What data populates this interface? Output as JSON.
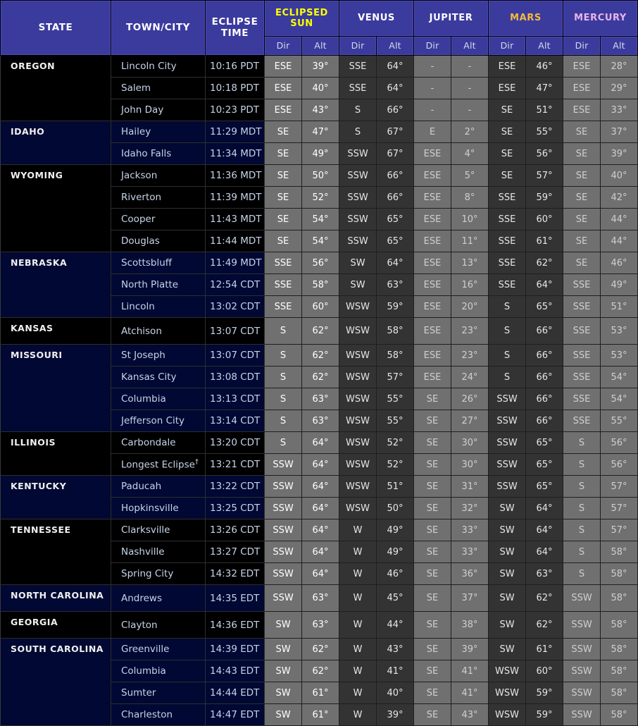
{
  "table": {
    "headers": {
      "state": "STATE",
      "town": "TOWN/CITY",
      "time": "ECLIPSE TIME",
      "time_line1": "ECLIPSE",
      "time_line2": "TIME",
      "groups": [
        {
          "label": "ECLIPSED SUN",
          "line1": "ECLIPSED",
          "line2": "SUN",
          "color": "#ffff00"
        },
        {
          "label": "VENUS",
          "color": "#ffffff"
        },
        {
          "label": "JUPITER",
          "color": "#fdfdff"
        },
        {
          "label": "MARS",
          "color": "#f2bb3d"
        },
        {
          "label": "MERCURY",
          "color": "#e8b5e8"
        }
      ],
      "sub": [
        "Dir",
        "Alt",
        "Dir",
        "Alt",
        "Dir",
        "Alt",
        "Dir",
        "Alt",
        "Dir",
        "Alt"
      ]
    },
    "colors": {
      "header_bg": "#3b3b9e",
      "block_a_bg": "#000000",
      "block_b_bg": "#000833",
      "light_cell_bg": "#707070",
      "dark_cell_bg": "#333333",
      "town_text": "#c6d4e8"
    },
    "states": [
      {
        "name": "OREGON",
        "block": "a",
        "rows": [
          {
            "town": "Lincoln City",
            "time": "10:16 PDT",
            "sun_dir": "ESE",
            "sun_alt": "39°",
            "venus_dir": "SSE",
            "venus_alt": "64°",
            "jupiter_dir": "-",
            "jupiter_alt": "-",
            "mars_dir": "ESE",
            "mars_alt": "46°",
            "mercury_dir": "ESE",
            "mercury_alt": "28°"
          },
          {
            "town": "Salem",
            "time": "10:18 PDT",
            "sun_dir": "ESE",
            "sun_alt": "40°",
            "venus_dir": "SSE",
            "venus_alt": "64°",
            "jupiter_dir": "-",
            "jupiter_alt": "-",
            "mars_dir": "ESE",
            "mars_alt": "47°",
            "mercury_dir": "ESE",
            "mercury_alt": "29°"
          },
          {
            "town": "John Day",
            "time": "10:23 PDT",
            "sun_dir": "ESE",
            "sun_alt": "43°",
            "venus_dir": "S",
            "venus_alt": "66°",
            "jupiter_dir": "-",
            "jupiter_alt": "-",
            "mars_dir": "SE",
            "mars_alt": "51°",
            "mercury_dir": "ESE",
            "mercury_alt": "33°"
          }
        ]
      },
      {
        "name": "IDAHO",
        "block": "b",
        "rows": [
          {
            "town": "Hailey",
            "time": "11:29 MDT",
            "sun_dir": "SE",
            "sun_alt": "47°",
            "venus_dir": "S",
            "venus_alt": "67°",
            "jupiter_dir": "E",
            "jupiter_alt": "2°",
            "mars_dir": "SE",
            "mars_alt": "55°",
            "mercury_dir": "SE",
            "mercury_alt": "37°"
          },
          {
            "town": "Idaho Falls",
            "time": "11:34 MDT",
            "sun_dir": "SE",
            "sun_alt": "49°",
            "venus_dir": "SSW",
            "venus_alt": "67°",
            "jupiter_dir": "ESE",
            "jupiter_alt": "4°",
            "mars_dir": "SE",
            "mars_alt": "56°",
            "mercury_dir": "SE",
            "mercury_alt": "39°"
          }
        ]
      },
      {
        "name": "WYOMING",
        "block": "a",
        "rows": [
          {
            "town": "Jackson",
            "time": "11:36 MDT",
            "sun_dir": "SE",
            "sun_alt": "50°",
            "venus_dir": "SSW",
            "venus_alt": "66°",
            "jupiter_dir": "ESE",
            "jupiter_alt": "5°",
            "mars_dir": "SE",
            "mars_alt": "57°",
            "mercury_dir": "SE",
            "mercury_alt": "40°"
          },
          {
            "town": "Riverton",
            "time": "11:39 MDT",
            "sun_dir": "SE",
            "sun_alt": "52°",
            "venus_dir": "SSW",
            "venus_alt": "66°",
            "jupiter_dir": "ESE",
            "jupiter_alt": "8°",
            "mars_dir": "SSE",
            "mars_alt": "59°",
            "mercury_dir": "SE",
            "mercury_alt": "42°"
          },
          {
            "town": "Cooper",
            "time": "11:43 MDT",
            "sun_dir": "SE",
            "sun_alt": "54°",
            "venus_dir": "SSW",
            "venus_alt": "65°",
            "jupiter_dir": "ESE",
            "jupiter_alt": "10°",
            "mars_dir": "SSE",
            "mars_alt": "60°",
            "mercury_dir": "SE",
            "mercury_alt": "44°"
          },
          {
            "town": "Douglas",
            "time": "11:44 MDT",
            "sun_dir": "SE",
            "sun_alt": "54°",
            "venus_dir": "SSW",
            "venus_alt": "65°",
            "jupiter_dir": "ESE",
            "jupiter_alt": "11°",
            "mars_dir": "SSE",
            "mars_alt": "61°",
            "mercury_dir": "SE",
            "mercury_alt": "44°"
          }
        ]
      },
      {
        "name": "NEBRASKA",
        "block": "b",
        "rows": [
          {
            "town": "Scottsbluff",
            "time": "11:49 MDT",
            "sun_dir": "SSE",
            "sun_alt": "56°",
            "venus_dir": "SW",
            "venus_alt": "64°",
            "jupiter_dir": "ESE",
            "jupiter_alt": "13°",
            "mars_dir": "SSE",
            "mars_alt": "62°",
            "mercury_dir": "SE",
            "mercury_alt": "46°"
          },
          {
            "town": "North Platte",
            "time": "12:54 CDT",
            "sun_dir": "SSE",
            "sun_alt": "58°",
            "venus_dir": "SW",
            "venus_alt": "63°",
            "jupiter_dir": "ESE",
            "jupiter_alt": "16°",
            "mars_dir": "SSE",
            "mars_alt": "64°",
            "mercury_dir": "SSE",
            "mercury_alt": "49°"
          },
          {
            "town": "Lincoln",
            "time": "13:02 CDT",
            "sun_dir": "SSE",
            "sun_alt": "60°",
            "venus_dir": "WSW",
            "venus_alt": "59°",
            "jupiter_dir": "ESE",
            "jupiter_alt": "20°",
            "mars_dir": "S",
            "mars_alt": "65°",
            "mercury_dir": "SSE",
            "mercury_alt": "51°"
          }
        ]
      },
      {
        "name": "KANSAS",
        "block": "a",
        "rows": [
          {
            "town": "Atchison",
            "time": "13:07 CDT",
            "sun_dir": "S",
            "sun_alt": "62°",
            "venus_dir": "WSW",
            "venus_alt": "58°",
            "jupiter_dir": "ESE",
            "jupiter_alt": "23°",
            "mars_dir": "S",
            "mars_alt": "66°",
            "mercury_dir": "SSE",
            "mercury_alt": "53°"
          }
        ]
      },
      {
        "name": "MISSOURI",
        "block": "b",
        "rows": [
          {
            "town": "St Joseph",
            "time": "13:07 CDT",
            "sun_dir": "S",
            "sun_alt": "62°",
            "venus_dir": "WSW",
            "venus_alt": "58°",
            "jupiter_dir": "ESE",
            "jupiter_alt": "23°",
            "mars_dir": "S",
            "mars_alt": "66°",
            "mercury_dir": "SSE",
            "mercury_alt": "53°"
          },
          {
            "town": "Kansas City",
            "time": "13:08 CDT",
            "sun_dir": "S",
            "sun_alt": "62°",
            "venus_dir": "WSW",
            "venus_alt": "57°",
            "jupiter_dir": "ESE",
            "jupiter_alt": "24°",
            "mars_dir": "S",
            "mars_alt": "66°",
            "mercury_dir": "SSE",
            "mercury_alt": "54°"
          },
          {
            "town": "Columbia",
            "time": "13:13 CDT",
            "sun_dir": "S",
            "sun_alt": "63°",
            "venus_dir": "WSW",
            "venus_alt": "55°",
            "jupiter_dir": "SE",
            "jupiter_alt": "26°",
            "mars_dir": "SSW",
            "mars_alt": "66°",
            "mercury_dir": "SSE",
            "mercury_alt": "54°"
          },
          {
            "town": "Jefferson City",
            "time": "13:14 CDT",
            "sun_dir": "S",
            "sun_alt": "63°",
            "venus_dir": "WSW",
            "venus_alt": "55°",
            "jupiter_dir": "SE",
            "jupiter_alt": "27°",
            "mars_dir": "SSW",
            "mars_alt": "66°",
            "mercury_dir": "SSE",
            "mercury_alt": "55°"
          }
        ]
      },
      {
        "name": "ILLINOIS",
        "block": "a",
        "rows": [
          {
            "town": "Carbondale",
            "time": "13:20 CDT",
            "sun_dir": "S",
            "sun_alt": "64°",
            "venus_dir": "WSW",
            "venus_alt": "52°",
            "jupiter_dir": "SE",
            "jupiter_alt": "30°",
            "mars_dir": "SSW",
            "mars_alt": "65°",
            "mercury_dir": "S",
            "mercury_alt": "56°"
          },
          {
            "town": "Longest Eclipse",
            "town_dagger": "†",
            "time": "13:21 CDT",
            "sun_dir": "SSW",
            "sun_alt": "64°",
            "venus_dir": "WSW",
            "venus_alt": "52°",
            "jupiter_dir": "SE",
            "jupiter_alt": "30°",
            "mars_dir": "SSW",
            "mars_alt": "65°",
            "mercury_dir": "S",
            "mercury_alt": "56°"
          }
        ]
      },
      {
        "name": "KENTUCKY",
        "block": "b",
        "rows": [
          {
            "town": "Paducah",
            "time": "13:22 CDT",
            "sun_dir": "SSW",
            "sun_alt": "64°",
            "venus_dir": "WSW",
            "venus_alt": "51°",
            "jupiter_dir": "SE",
            "jupiter_alt": "31°",
            "mars_dir": "SSW",
            "mars_alt": "65°",
            "mercury_dir": "S",
            "mercury_alt": "57°"
          },
          {
            "town": "Hopkinsville",
            "time": "13:25 CDT",
            "sun_dir": "SSW",
            "sun_alt": "64°",
            "venus_dir": "WSW",
            "venus_alt": "50°",
            "jupiter_dir": "SE",
            "jupiter_alt": "32°",
            "mars_dir": "SW",
            "mars_alt": "64°",
            "mercury_dir": "S",
            "mercury_alt": "57°"
          }
        ]
      },
      {
        "name": "TENNESSEE",
        "block": "a",
        "rows": [
          {
            "town": "Clarksville",
            "time": "13:26 CDT",
            "sun_dir": "SSW",
            "sun_alt": "64°",
            "venus_dir": "W",
            "venus_alt": "49°",
            "jupiter_dir": "SE",
            "jupiter_alt": "33°",
            "mars_dir": "SW",
            "mars_alt": "64°",
            "mercury_dir": "S",
            "mercury_alt": "57°"
          },
          {
            "town": "Nashville",
            "time": "13:27 CDT",
            "sun_dir": "SSW",
            "sun_alt": "64°",
            "venus_dir": "W",
            "venus_alt": "49°",
            "jupiter_dir": "SE",
            "jupiter_alt": "33°",
            "mars_dir": "SW",
            "mars_alt": "64°",
            "mercury_dir": "S",
            "mercury_alt": "58°"
          },
          {
            "town": "Spring City",
            "time": "14:32 EDT",
            "sun_dir": "SSW",
            "sun_alt": "64°",
            "venus_dir": "W",
            "venus_alt": "46°",
            "jupiter_dir": "SE",
            "jupiter_alt": "36°",
            "mars_dir": "SW",
            "mars_alt": "63°",
            "mercury_dir": "S",
            "mercury_alt": "58°"
          }
        ]
      },
      {
        "name": "NORTH CAROLINA",
        "block": "b",
        "rows": [
          {
            "town": "Andrews",
            "time": "14:35 EDT",
            "sun_dir": "SSW",
            "sun_alt": "63°",
            "venus_dir": "W",
            "venus_alt": "45°",
            "jupiter_dir": "SE",
            "jupiter_alt": "37°",
            "mars_dir": "SW",
            "mars_alt": "62°",
            "mercury_dir": "SSW",
            "mercury_alt": "58°"
          }
        ]
      },
      {
        "name": "GEORGIA",
        "block": "a",
        "rows": [
          {
            "town": "Clayton",
            "time": "14:36 EDT",
            "sun_dir": "SW",
            "sun_alt": "63°",
            "venus_dir": "W",
            "venus_alt": "44°",
            "jupiter_dir": "SE",
            "jupiter_alt": "38°",
            "mars_dir": "SW",
            "mars_alt": "62°",
            "mercury_dir": "SSW",
            "mercury_alt": "58°"
          }
        ]
      },
      {
        "name": "SOUTH CAROLINA",
        "block": "b",
        "rows": [
          {
            "town": "Greenville",
            "time": "14:39 EDT",
            "sun_dir": "SW",
            "sun_alt": "62°",
            "venus_dir": "W",
            "venus_alt": "43°",
            "jupiter_dir": "SE",
            "jupiter_alt": "39°",
            "mars_dir": "SW",
            "mars_alt": "61°",
            "mercury_dir": "SSW",
            "mercury_alt": "58°"
          },
          {
            "town": "Columbia",
            "time": "14:43 EDT",
            "sun_dir": "SW",
            "sun_alt": "62°",
            "venus_dir": "W",
            "venus_alt": "41°",
            "jupiter_dir": "SE",
            "jupiter_alt": "41°",
            "mars_dir": "WSW",
            "mars_alt": "60°",
            "mercury_dir": "SSW",
            "mercury_alt": "58°"
          },
          {
            "town": "Sumter",
            "time": "14:44 EDT",
            "sun_dir": "SW",
            "sun_alt": "61°",
            "venus_dir": "W",
            "venus_alt": "40°",
            "jupiter_dir": "SE",
            "jupiter_alt": "41°",
            "mars_dir": "WSW",
            "mars_alt": "59°",
            "mercury_dir": "SSW",
            "mercury_alt": "58°"
          },
          {
            "town": "Charleston",
            "time": "14:47 EDT",
            "sun_dir": "SW",
            "sun_alt": "61°",
            "venus_dir": "W",
            "venus_alt": "39°",
            "jupiter_dir": "SE",
            "jupiter_alt": "43°",
            "mars_dir": "WSW",
            "mars_alt": "59°",
            "mercury_dir": "SSW",
            "mercury_alt": "58°"
          }
        ]
      }
    ]
  }
}
